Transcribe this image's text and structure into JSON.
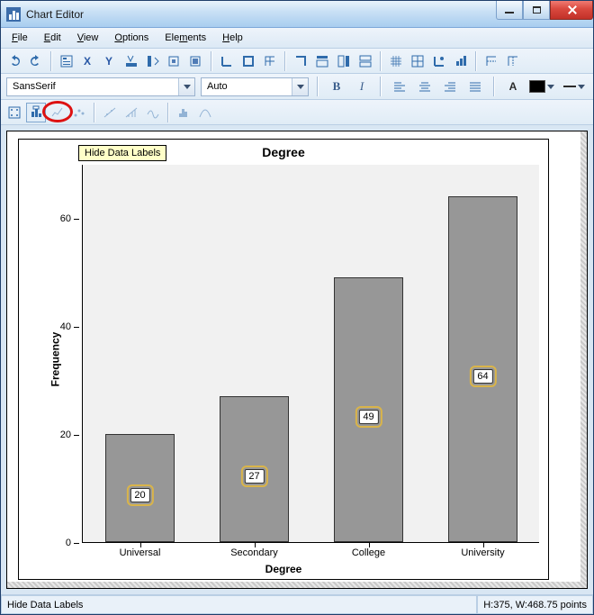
{
  "window": {
    "title": "Chart Editor"
  },
  "menu": {
    "file": "File",
    "edit": "Edit",
    "view": "View",
    "options": "Options",
    "elements": "Elements",
    "help": "Help"
  },
  "font": {
    "family": "SansSerif",
    "size": "Auto",
    "bold": "B",
    "italic": "I",
    "letter": "A"
  },
  "tooltip": {
    "hide_labels": "Hide Data Labels"
  },
  "status": {
    "left": "Hide Data Labels",
    "right": "H:375, W:468.75 points"
  },
  "chart_data": {
    "type": "bar",
    "title": "Degree",
    "xlabel": "Degree",
    "ylabel": "Frequency",
    "categories": [
      "Universal",
      "Secondary",
      "College",
      "University"
    ],
    "values": [
      20,
      27,
      49,
      64
    ],
    "yticks": [
      0,
      20,
      40,
      60
    ],
    "ylim": [
      0,
      70
    ]
  }
}
